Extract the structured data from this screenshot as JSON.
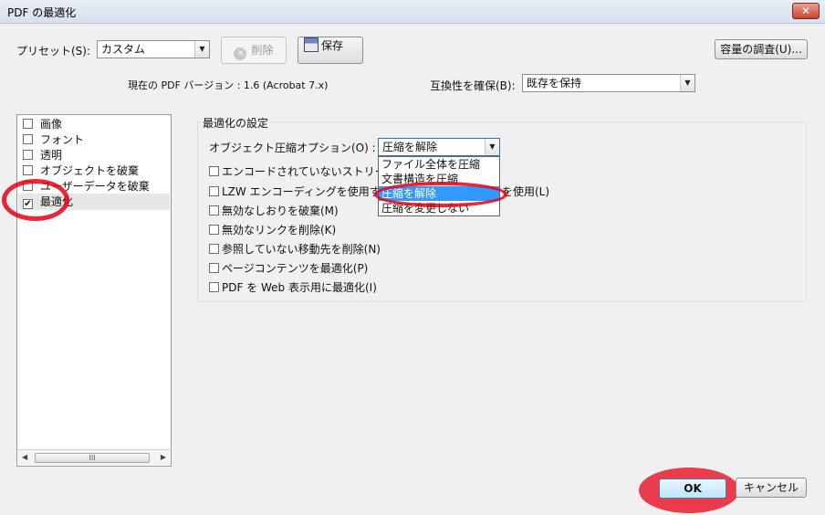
{
  "window": {
    "title": "PDF の最適化",
    "close_glyph": "✕"
  },
  "preset": {
    "label": "プリセット(S):",
    "value": "カスタム"
  },
  "buttons": {
    "delete": "削除",
    "save": "保存",
    "capacity": "容量の調査(U)...",
    "ok": "OK",
    "cancel": "キャンセル"
  },
  "version": {
    "current_text": "現在の PDF バージョン : 1.6 (Acrobat 7.x)",
    "compat_label": "互換性を確保(B):",
    "compat_value": "既存を保持"
  },
  "sidebar": {
    "items": [
      {
        "label": "画像",
        "checked": false
      },
      {
        "label": "フォント",
        "checked": false
      },
      {
        "label": "透明",
        "checked": false
      },
      {
        "label": "オブジェクトを破棄",
        "checked": false
      },
      {
        "label": "ユーザーデータを破棄",
        "checked": false
      },
      {
        "label": "最適化",
        "checked": true
      }
    ],
    "scroll_thumb_glyph": "III"
  },
  "settings": {
    "group_title": "最適化の設定",
    "compression_label": "オブジェクト圧縮オプション(O) :",
    "compression_value": "圧縮を解除",
    "options_dropdown": [
      "ファイル全体を圧縮",
      "文書構造を圧縮",
      "圧縮を解除",
      "圧縮を変更しない"
    ],
    "checkboxes": [
      {
        "label": "エンコードされていないストリームを",
        "suffix": ""
      },
      {
        "label": "LZW エンコーディングを使用す",
        "suffix": "を使用(L)"
      },
      {
        "label": "無効なしおりを破棄(M)",
        "suffix": ""
      },
      {
        "label": "無効なリンクを削除(K)",
        "suffix": ""
      },
      {
        "label": "参照していない移動先を削除(N)",
        "suffix": ""
      },
      {
        "label": "ページコンテンツを最適化(P)",
        "suffix": ""
      },
      {
        "label": "PDF を Web 表示用に最適化(I)",
        "suffix": ""
      }
    ]
  },
  "colors": {
    "highlight": "#3399ff",
    "annotation_red": "#e80014"
  }
}
